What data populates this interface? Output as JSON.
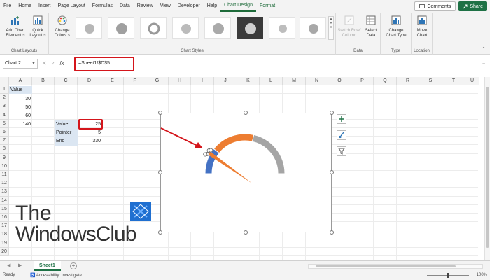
{
  "menubar": {
    "items": [
      "File",
      "Home",
      "Insert",
      "Page Layout",
      "Formulas",
      "Data",
      "Review",
      "View",
      "Developer",
      "Help",
      "Chart Design",
      "Format"
    ],
    "active": "Chart Design",
    "comments_label": "Comments",
    "share_label": "Share"
  },
  "ribbon": {
    "groups": {
      "chart_layouts": "Chart Layouts",
      "chart_styles": "Chart Styles",
      "data": "Data",
      "type": "Type",
      "location": "Location"
    },
    "buttons": {
      "add_chart_element_1": "Add Chart",
      "add_chart_element_2": "Element ~",
      "quick_layout_1": "Quick",
      "quick_layout_2": "Layout ~",
      "change_colors_1": "Change",
      "change_colors_2": "Colors ~",
      "switch_row_1": "Switch Row/",
      "switch_row_2": "Column",
      "select_data_1": "Select",
      "select_data_2": "Data",
      "change_type_1": "Change",
      "change_type_2": "Chart Type",
      "move_chart_1": "Move",
      "move_chart_2": "Chart"
    }
  },
  "formulabar": {
    "name_box": "Chart 2",
    "formula": "=Sheet1!$D$5",
    "fx": "fx"
  },
  "columns": [
    "A",
    "B",
    "C",
    "D",
    "E",
    "F",
    "G",
    "H",
    "I",
    "J",
    "K",
    "L",
    "M",
    "N",
    "O",
    "P",
    "Q",
    "R",
    "S",
    "T",
    "U"
  ],
  "rows": [
    "1",
    "2",
    "3",
    "4",
    "5",
    "6",
    "7",
    "8",
    "9",
    "10",
    "11",
    "12",
    "13",
    "14",
    "15",
    "16",
    "17",
    "18",
    "19",
    "20"
  ],
  "cells": {
    "A1": "Value",
    "A2": "30",
    "A3": "50",
    "A4": "60",
    "A5": "140",
    "C5": "Value",
    "D5": "25",
    "C6": "Pointer",
    "D6": "5",
    "C7": "End",
    "D7": "330"
  },
  "chart": {
    "segments": [
      {
        "value": 30,
        "color": "#4472c4"
      },
      {
        "value": 50,
        "color": "#ed7d31"
      },
      {
        "value": 60,
        "color": "#a5a5a5"
      },
      {
        "value": 140,
        "color": "#ffffff"
      }
    ],
    "pointer_color": "#ed7d31"
  },
  "colors": {
    "accent": "#1e7145",
    "highlight_red": "#d4151b"
  },
  "watermark": {
    "line1": "The",
    "line2": "WindowsClub"
  },
  "sheet_tabs": {
    "active": "Sheet1"
  },
  "statusbar": {
    "ready": "Ready",
    "accessibility": "Accessibility: Investigate",
    "zoom": "100%"
  }
}
